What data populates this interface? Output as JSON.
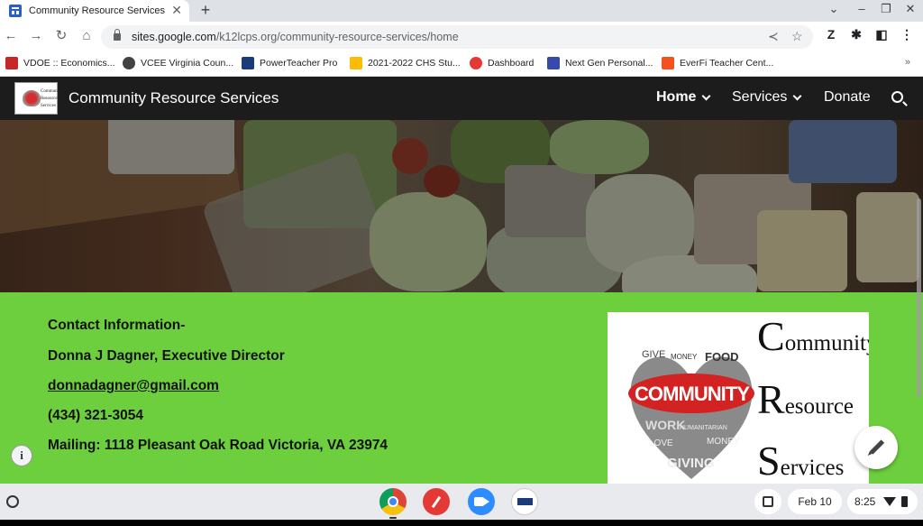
{
  "browser": {
    "tab_title": "Community Resource Services",
    "tab_close": "✕",
    "new_tab": "+",
    "window_controls": [
      "⌄",
      "–",
      "❐",
      "✕"
    ],
    "nav": {
      "back": "←",
      "forward": "→",
      "reload": "↻",
      "home": "⌂"
    },
    "url_host": "sites.google.com",
    "url_path": "/k12lcps.org/community-resource-services/home",
    "share": "≺",
    "star": "☆",
    "extensions": [
      "Z",
      "✱",
      "◧",
      "⋮"
    ],
    "bookmarks": [
      {
        "label": "VDOE :: Economics...",
        "color": "#c62828"
      },
      {
        "label": "VCEE Virginia Coun...",
        "color": "#424242"
      },
      {
        "label": "PowerTeacher Pro",
        "color": "#1a3a7a"
      },
      {
        "label": "2021-2022 CHS Stu...",
        "color": "#fbbc04"
      },
      {
        "label": "Dashboard",
        "color": "#e53935"
      },
      {
        "label": "Next Gen Personal...",
        "color": "#3949ab"
      },
      {
        "label": "EverFi Teacher Cent...",
        "color": "#f4511e"
      }
    ],
    "bookmarks_more": "»"
  },
  "site": {
    "title": "Community Resource Services",
    "logo_lines": [
      "Community",
      "Resource",
      "Services"
    ],
    "nav": [
      {
        "label": "Home",
        "dropdown": true
      },
      {
        "label": "Services",
        "dropdown": true
      },
      {
        "label": "Donate",
        "dropdown": false
      }
    ]
  },
  "contact": {
    "heading": "Contact Information-",
    "name": "Donna J Dagner, Executive Director",
    "email": "donnadagner@gmail.com",
    "phone": "(434) 321-3054",
    "mailing": "Mailing: 1118 Pleasant Oak Road Victoria, VA 23974"
  },
  "crs_logo": {
    "letters": [
      {
        "cap": "C",
        "rest": "ommunity"
      },
      {
        "cap": "R",
        "rest": "esource"
      },
      {
        "cap": "S",
        "rest": "ervices"
      }
    ],
    "heart_words": [
      "GIVE",
      "MONEY",
      "FOOD",
      "COMMUNITY",
      "WORK",
      "HUMANITARIAN",
      "LOVE",
      "MONEY",
      "GIVING"
    ]
  },
  "info_button": "i",
  "shelf": {
    "date": "Feb 10",
    "time": "8:25"
  }
}
